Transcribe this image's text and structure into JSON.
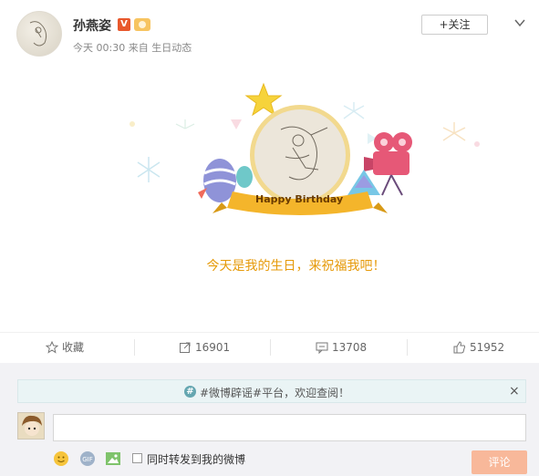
{
  "header": {
    "username": "孙燕姿",
    "verified_badge": "V",
    "meta": "今天 00:30 来自 生日动态",
    "follow_label": "+关注",
    "chevron_icon": "chevron-down-icon"
  },
  "card": {
    "ribbon_text": "Happy Birthday",
    "message": "今天是我的生日，来祝福我吧！"
  },
  "actions": {
    "favorite_label": "收藏",
    "share_count": "16901",
    "comment_count": "13708",
    "like_count": "51952"
  },
  "comment": {
    "notice_text": "#微博辟谣#平台，欢迎查阅！",
    "notice_close": "×",
    "input_value": "",
    "repost_label": "同时转发到我的微博",
    "submit_label": "评论"
  },
  "colors": {
    "accent": "#f77c3d",
    "birthday_text": "#e69a0a",
    "ribbon": "#f4b52b"
  }
}
